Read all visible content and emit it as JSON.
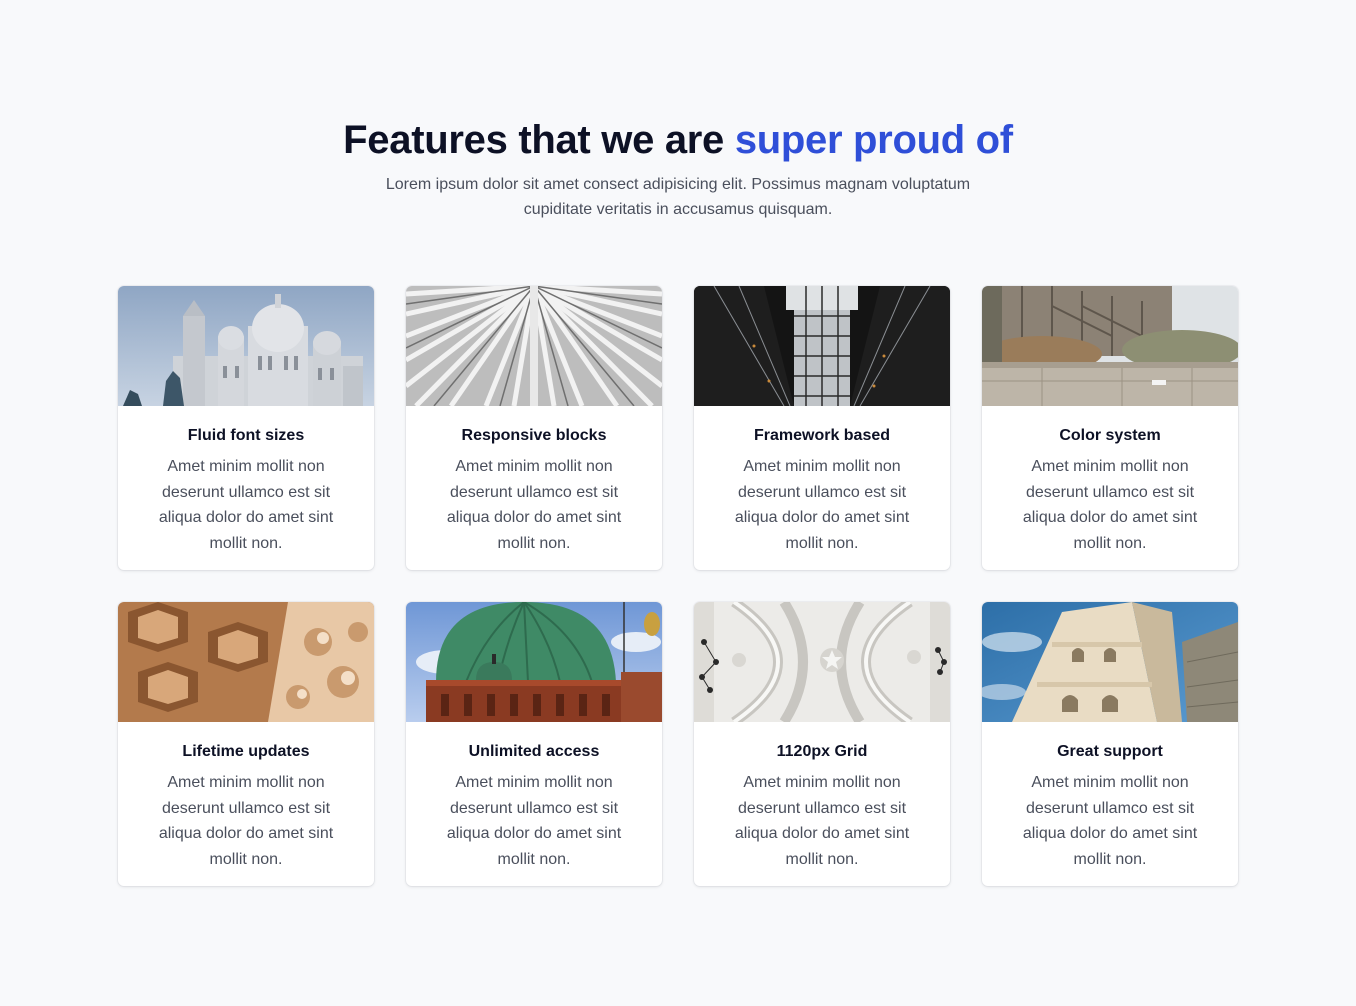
{
  "header": {
    "title_main": "Features that we are ",
    "title_accent": "super proud of",
    "subtitle": "Lorem ipsum dolor sit amet consect adipisicing elit. Possimus magnam voluptatum cupiditate veritatis in accusamus quisquam."
  },
  "colors": {
    "accent": "#2f4fd8",
    "heading": "#0d1125",
    "body_text": "#4a4f5c",
    "background": "#f8f9fb"
  },
  "features": [
    {
      "title": "Fluid font sizes",
      "description": "Amet minim mollit non deserunt ullamco est sit aliqua dolor do amet sint mollit non.",
      "image": "basilica-photo"
    },
    {
      "title": "Responsive blocks",
      "description": "Amet minim mollit non deserunt ullamco est sit aliqua dolor do amet sint mollit non.",
      "image": "white-ribs-architecture-photo"
    },
    {
      "title": "Framework based",
      "description": "Amet minim mollit non deserunt ullamco est sit aliqua dolor do amet sint mollit non.",
      "image": "glass-atrium-photo"
    },
    {
      "title": "Color system",
      "description": "Amet minim mollit non deserunt ullamco est sit aliqua dolor do amet sint mollit non.",
      "image": "gothic-cathedral-photo"
    },
    {
      "title": "Lifetime updates",
      "description": "Amet minim mollit non deserunt ullamco est sit aliqua dolor do amet sint mollit non.",
      "image": "ornate-ceiling-photo"
    },
    {
      "title": "Unlimited access",
      "description": "Amet minim mollit non deserunt ullamco est sit aliqua dolor do amet sint mollit non.",
      "image": "green-dome-photo"
    },
    {
      "title": "1120px Grid",
      "description": "Amet minim mollit non deserunt ullamco est sit aliqua dolor do amet sint mollit non.",
      "image": "white-vault-ceiling-photo"
    },
    {
      "title": "Great support",
      "description": "Amet minim mollit non deserunt ullamco est sit aliqua dolor do amet sint mollit non.",
      "image": "stone-tower-photo"
    }
  ]
}
